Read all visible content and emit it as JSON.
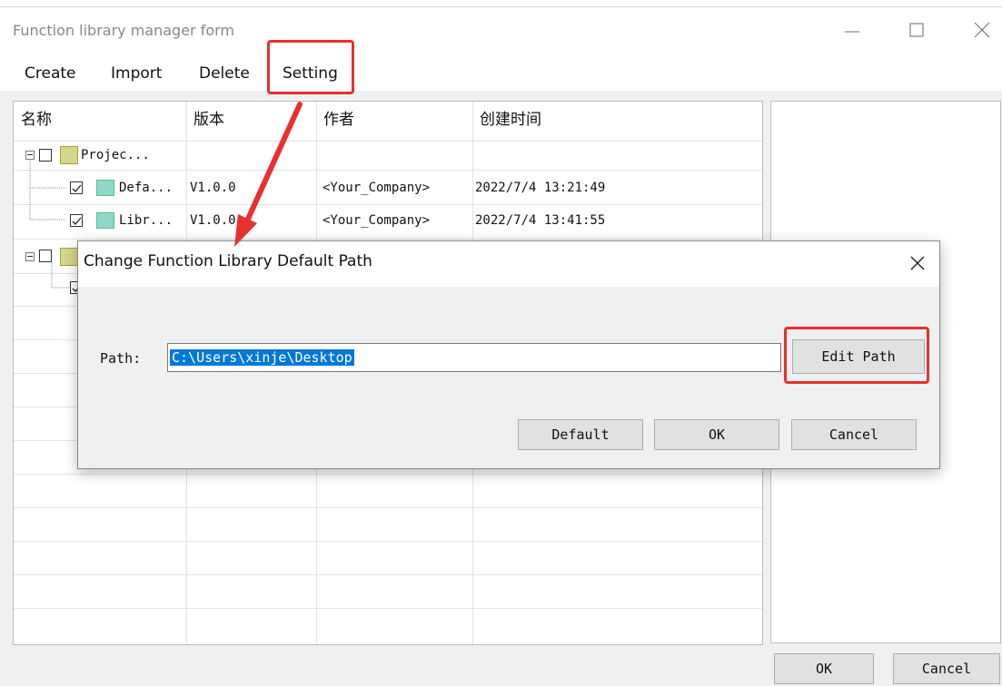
{
  "window": {
    "title": "Function library manager form"
  },
  "menu": {
    "items": [
      "Create",
      "Import",
      "Delete",
      "Setting"
    ]
  },
  "grid": {
    "columns": [
      "名称",
      "版本",
      "作者",
      "创建时间"
    ],
    "rows": [
      {
        "name": "Projec...",
        "version": "",
        "author": "",
        "created": ""
      },
      {
        "name": "Defa...",
        "version": "V1.0.0",
        "author": "<Your_Company>",
        "created": "2022/7/4 13:21:49"
      },
      {
        "name": "Libr...",
        "version": "V1.0.0",
        "author": "<Your_Company>",
        "created": "2022/7/4 13:41:55"
      }
    ]
  },
  "footer": {
    "ok": "OK",
    "cancel": "Cancel"
  },
  "dialog": {
    "title": "Change Function Library Default Path",
    "path_label": "Path:",
    "path_value": "C:\\Users\\xinje\\Desktop",
    "edit_path": "Edit Path",
    "default": "Default",
    "ok": "OK",
    "cancel": "Cancel"
  }
}
